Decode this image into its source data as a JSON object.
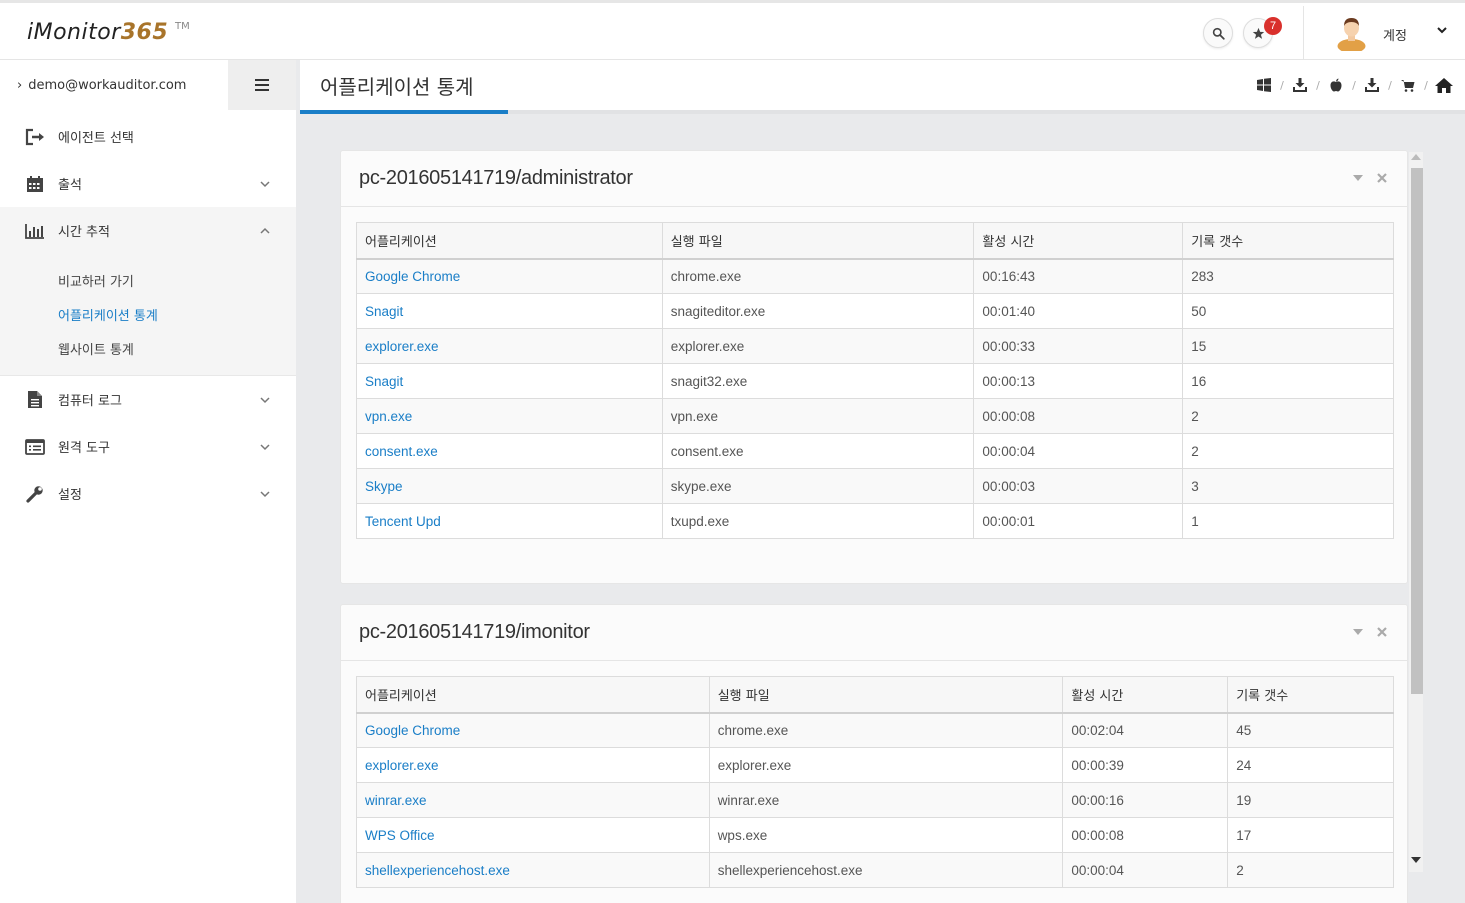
{
  "header": {
    "logo_text": "iMonitor",
    "logo_num": "365",
    "logo_tm": "TM",
    "notification_count": "7",
    "account_label": "계정"
  },
  "sidebar": {
    "user_email": "demo@workauditor.com",
    "items": [
      {
        "label": "에이전트 선택",
        "icon": "sign-out-icon"
      },
      {
        "label": "출석",
        "icon": "calendar-icon"
      },
      {
        "label": "시간 추적",
        "icon": "bar-chart-icon"
      },
      {
        "label": "컴퓨터 로그",
        "icon": "file-icon"
      },
      {
        "label": "원격 도구",
        "icon": "list-icon"
      },
      {
        "label": "설정",
        "icon": "wrench-icon"
      }
    ],
    "submenu": [
      {
        "label": "비교하러 가기"
      },
      {
        "label": "어플리케이션 통계"
      },
      {
        "label": "웹사이트 통계"
      }
    ]
  },
  "page": {
    "title": "어플리케이션 통계",
    "breadcrumb_icons": [
      "windows-icon",
      "download-icon",
      "apple-icon",
      "download-icon",
      "cart-icon",
      "home-icon"
    ]
  },
  "panels": [
    {
      "title": "pc-201605141719/administrator",
      "columns": [
        "어플리케이션",
        "실행 파일",
        "활성 시간",
        "기록 갯수"
      ],
      "rows": [
        [
          "Google Chrome",
          "chrome.exe",
          "00:16:43",
          "283"
        ],
        [
          "Snagit",
          "snagiteditor.exe",
          "00:01:40",
          "50"
        ],
        [
          "explorer.exe",
          "explorer.exe",
          "00:00:33",
          "15"
        ],
        [
          "Snagit",
          "snagit32.exe",
          "00:00:13",
          "16"
        ],
        [
          "vpn.exe",
          "vpn.exe",
          "00:00:08",
          "2"
        ],
        [
          "consent.exe",
          "consent.exe",
          "00:00:04",
          "2"
        ],
        [
          "Skype",
          "skype.exe",
          "00:00:03",
          "3"
        ],
        [
          "Tencent Upd",
          "txupd.exe",
          "00:00:01",
          "1"
        ]
      ]
    },
    {
      "title": "pc-201605141719/imonitor",
      "columns": [
        "어플리케이션",
        "실행 파일",
        "활성 시간",
        "기록 갯수"
      ],
      "rows": [
        [
          "Google Chrome",
          "chrome.exe",
          "00:02:04",
          "45"
        ],
        [
          "explorer.exe",
          "explorer.exe",
          "00:00:39",
          "24"
        ],
        [
          "winrar.exe",
          "winrar.exe",
          "00:00:16",
          "19"
        ],
        [
          "WPS Office",
          "wps.exe",
          "00:00:08",
          "17"
        ],
        [
          "shellexperiencehost.exe",
          "shellexperiencehost.exe",
          "00:00:04",
          "2"
        ]
      ]
    }
  ],
  "colors": {
    "accent": "#1a7ec7",
    "badge": "#d9302c",
    "logo_num": "#a8742a"
  }
}
